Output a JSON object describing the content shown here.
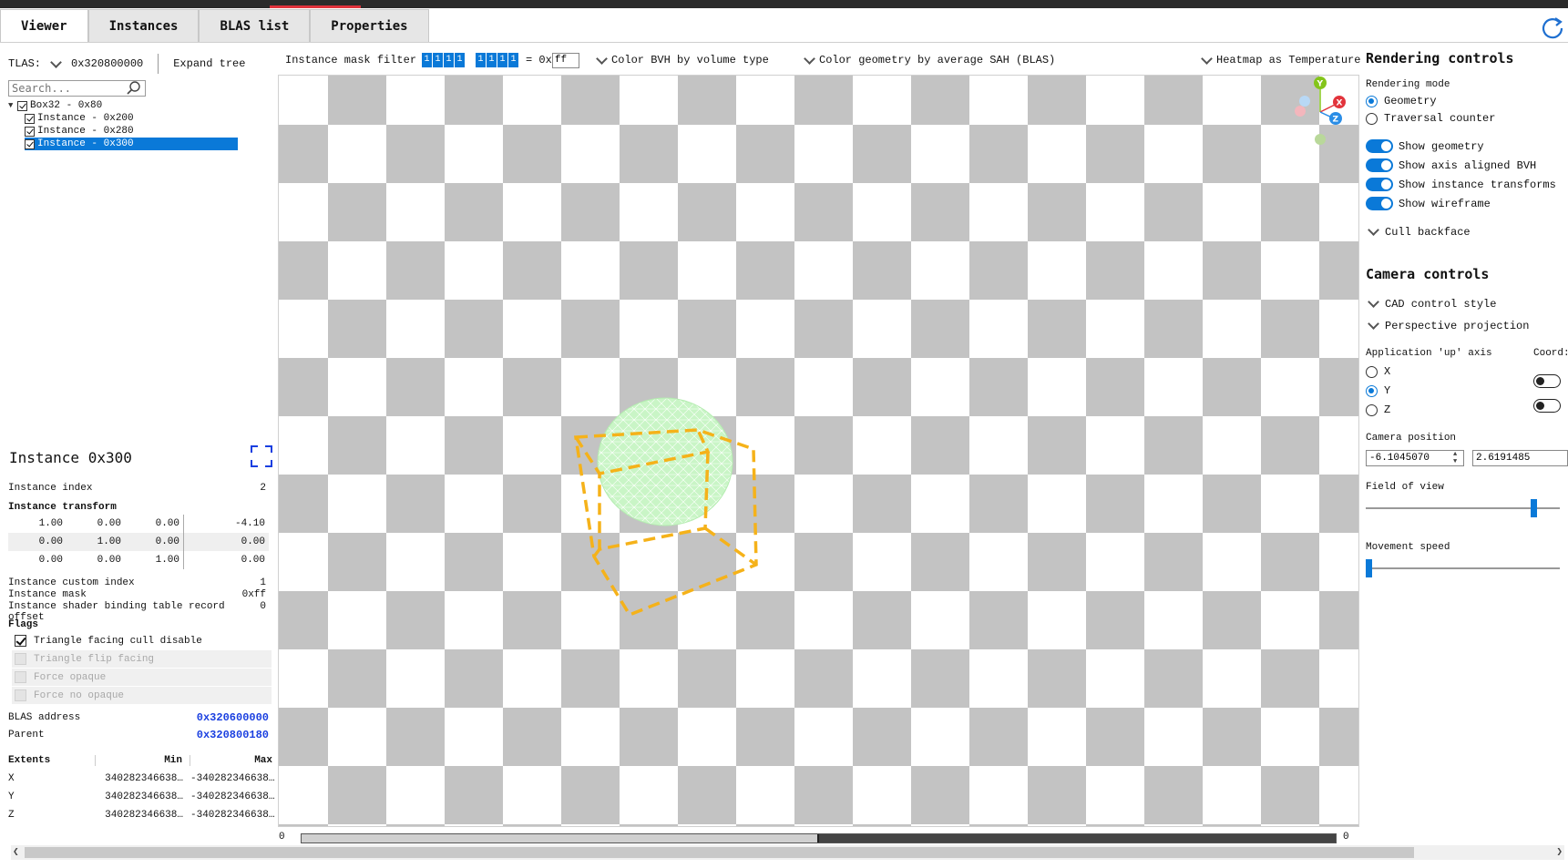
{
  "tabs": [
    "Viewer",
    "Instances",
    "BLAS list",
    "Properties"
  ],
  "tlas": {
    "label": "TLAS:",
    "value": "0x320800000",
    "expand_label": "Expand tree"
  },
  "search": {
    "placeholder": "Search..."
  },
  "tree": [
    {
      "label": "Box32 - 0x80",
      "level": 0,
      "selected": false
    },
    {
      "label": "Instance - 0x200",
      "level": 1,
      "selected": false
    },
    {
      "label": "Instance - 0x280",
      "level": 1,
      "selected": false
    },
    {
      "label": "Instance - 0x300",
      "level": 1,
      "selected": true
    }
  ],
  "instance": {
    "title": "Instance 0x300",
    "index_label": "Instance index",
    "index_value": "2",
    "transform_label": "Instance transform",
    "transform": [
      [
        "1.00",
        "0.00",
        "0.00",
        "-4.10"
      ],
      [
        "0.00",
        "1.00",
        "0.00",
        "0.00"
      ],
      [
        "0.00",
        "0.00",
        "1.00",
        "0.00"
      ]
    ],
    "custom_index_label": "Instance custom index",
    "custom_index_value": "1",
    "mask_label": "Instance mask",
    "mask_value": "0xff",
    "sbt_label": "Instance shader binding table record offset",
    "sbt_value": "0",
    "flags_label": "Flags",
    "flags": [
      {
        "label": "Triangle facing cull disable",
        "checked": true,
        "enabled": true
      },
      {
        "label": "Triangle flip facing",
        "checked": false,
        "enabled": false
      },
      {
        "label": "Force opaque",
        "checked": false,
        "enabled": false
      },
      {
        "label": "Force no opaque",
        "checked": false,
        "enabled": false
      }
    ],
    "blas_label": "BLAS address",
    "blas_value": "0x320600000",
    "parent_label": "Parent",
    "parent_value": "0x320800180",
    "extents_headers": [
      "Extents",
      "Min",
      "Max"
    ],
    "extents": [
      [
        "X",
        "340282346638…",
        "-340282346638…"
      ],
      [
        "Y",
        "340282346638…",
        "-340282346638…"
      ],
      [
        "Z",
        "340282346638…",
        "-340282346638…"
      ]
    ]
  },
  "toolbar": {
    "mask_filter_label": "Instance mask filter",
    "mask_bits_a": [
      "1",
      "1",
      "1",
      "1"
    ],
    "mask_bits_b": [
      "1",
      "1",
      "1",
      "1"
    ],
    "mask_eq": "= 0x",
    "mask_hex": "ff",
    "color_bvh": "Color BVH by volume type",
    "color_geometry": "Color geometry by average SAH (BLAS)",
    "heatmap": "Heatmap as Temperature"
  },
  "viewport": {
    "slider_min": "0",
    "slider_max": "0",
    "slider_fraction": 0.5,
    "axis_labels": [
      "Y",
      "X",
      "Z"
    ],
    "colors": {
      "accent": "#0a79d8",
      "bbox": "#f5b21a",
      "sphere": "#c9f5c6",
      "checker": "#c3c3c3"
    }
  },
  "rendering": {
    "title": "Rendering controls",
    "mode_label": "Rendering mode",
    "modes": [
      {
        "label": "Geometry",
        "checked": true
      },
      {
        "label": "Traversal counter",
        "checked": false
      }
    ],
    "toggles": [
      "Show geometry",
      "Show axis aligned BVH",
      "Show instance transforms",
      "Show wireframe"
    ],
    "cull": "Cull backface"
  },
  "camera": {
    "title": "Camera controls",
    "cad": "CAD control style",
    "perspective": "Perspective projection",
    "up_axis_label": "Application 'up' axis",
    "coord_label": "Coord:",
    "axes": [
      {
        "label": "X",
        "checked": false
      },
      {
        "label": "Y",
        "checked": true
      },
      {
        "label": "Z",
        "checked": false
      }
    ],
    "position_label": "Camera position",
    "position_x": "-6.1045070",
    "position_y": "2.6191485",
    "fov_label": "Field of view",
    "fov_fraction": 0.88,
    "speed_label": "Movement speed",
    "speed_fraction": 0.0
  }
}
